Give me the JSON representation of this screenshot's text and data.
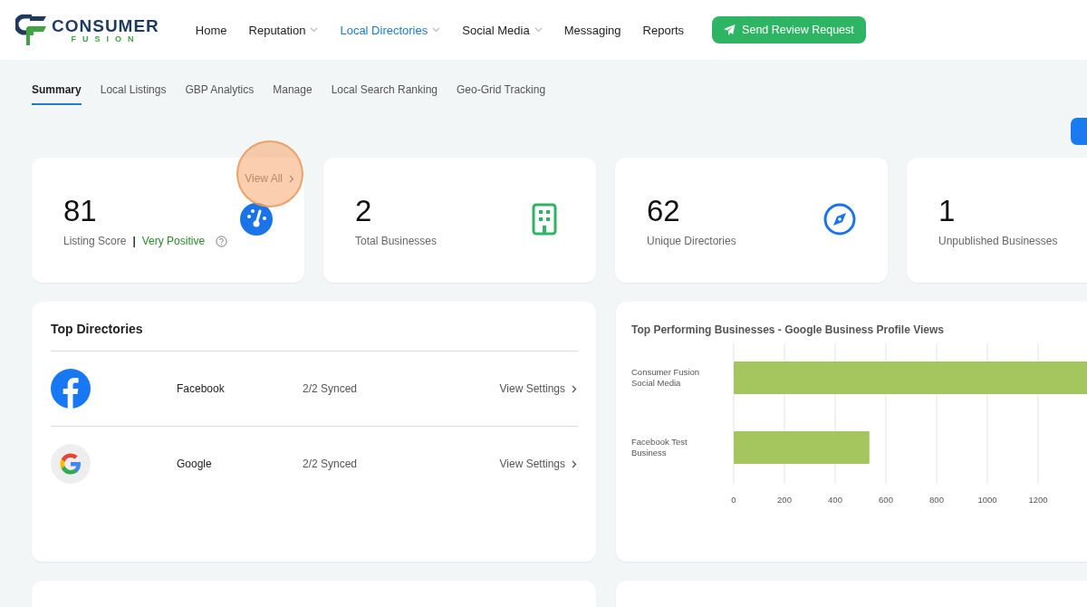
{
  "header": {
    "logo": {
      "word": "CONSUMER",
      "sub": "FUSION"
    },
    "nav": [
      {
        "label": "Home",
        "selected": false,
        "dropdown": false
      },
      {
        "label": "Reputation",
        "selected": false,
        "dropdown": true
      },
      {
        "label": "Local Directories",
        "selected": true,
        "dropdown": true
      },
      {
        "label": "Social Media",
        "selected": false,
        "dropdown": true
      },
      {
        "label": "Messaging",
        "selected": false,
        "dropdown": false
      },
      {
        "label": "Reports",
        "selected": false,
        "dropdown": false
      }
    ],
    "cta": "Send Review Request"
  },
  "tabs": [
    {
      "label": "Summary",
      "selected": true
    },
    {
      "label": "Local Listings",
      "selected": false
    },
    {
      "label": "GBP Analytics",
      "selected": false
    },
    {
      "label": "Manage",
      "selected": false
    },
    {
      "label": "Local Search Ranking",
      "selected": false
    },
    {
      "label": "Geo-Grid Tracking",
      "selected": false
    }
  ],
  "stats": [
    {
      "value": "81",
      "label": "Listing Score",
      "separator": "|",
      "rating": "Very Positive",
      "link": "View All",
      "kind": "gauge"
    },
    {
      "value": "2",
      "label": "Total Businesses",
      "kind": "building"
    },
    {
      "value": "62",
      "label": "Unique Directories",
      "kind": "compass"
    },
    {
      "value": "1",
      "label": "Unpublished Businesses",
      "kind": "none"
    }
  ],
  "top_directories": {
    "title": "Top Directories",
    "rows": [
      {
        "name": "Facebook",
        "synced": "2/2 Synced",
        "action": "View Settings",
        "kind": "facebook"
      },
      {
        "name": "Google",
        "synced": "2/2 Synced",
        "action": "View Settings",
        "kind": "google"
      }
    ]
  },
  "chart_card": {
    "title": "Top Performing Businesses - Google Business Profile Views",
    "chart_data": {
      "type": "bar",
      "orientation": "horizontal",
      "categories": [
        "Consumer Fusion Social Media",
        "Facebook Test Business"
      ],
      "series": [
        {
          "color": "#a5c65f",
          "values": [
            1400,
            535
          ]
        }
      ],
      "grid": true,
      "xlim": [
        0,
        1400
      ],
      "xticks": [
        0,
        200,
        400,
        600,
        800,
        1000,
        1200
      ]
    }
  }
}
